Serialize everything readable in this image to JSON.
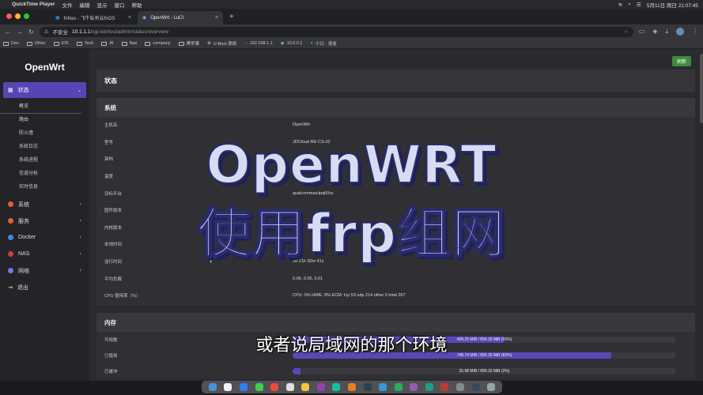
{
  "menubar": {
    "app_name": "QuickTime Player",
    "menus": [
      "文件",
      "编辑",
      "显示",
      "窗口",
      "帮助"
    ],
    "datetime": "5月11日 周日 21:07:45"
  },
  "tabs": [
    {
      "label": "fnNas - 飞牛私有云fnOS"
    },
    {
      "label": "OpenWrt - LuCI"
    }
  ],
  "address": {
    "security": "不安全",
    "host": "10.1.1.1",
    "path": "/cgi-bin/luci/admin/status/overview"
  },
  "bookmarks": [
    "Dev",
    "Other",
    "iOS",
    "Tech",
    "AI",
    "Nas",
    "company",
    "黑苹果",
    "U-Boot 更新",
    "192.168.1.1",
    "10.0.0.1",
    "小记 · 语雀"
  ],
  "sidebar": {
    "logo": "OpenWrt",
    "active_section": "状态",
    "subitems": [
      "概览",
      "路由",
      "防火墙",
      "系统日志",
      "系统进程",
      "信道分析",
      "实时信息"
    ],
    "items": [
      {
        "label": "系统",
        "color": "#e0603a"
      },
      {
        "label": "服务",
        "color": "#e0603a"
      },
      {
        "label": "Docker",
        "color": "#3b8de0"
      },
      {
        "label": "NAS",
        "color": "#d03c3c"
      },
      {
        "label": "网络",
        "color": "#6a7fe0"
      },
      {
        "label": "退出",
        "color": "#cccccc"
      }
    ]
  },
  "content": {
    "refresh": "刷新",
    "page_title": "状态",
    "system_title": "系统",
    "system_rows": [
      {
        "k": "主机名",
        "v": "OpenWrt"
      },
      {
        "k": "型号",
        "v": "JDCloud RE-CS-02"
      },
      {
        "k": "架构",
        "v": ""
      },
      {
        "k": "温度",
        "v": ""
      },
      {
        "k": "目标平台",
        "v": "qualcommax/ipq60xx"
      },
      {
        "k": "固件版本",
        "v": ""
      },
      {
        "k": "内核版本",
        "v": ""
      },
      {
        "k": "本地时间",
        "v": ""
      },
      {
        "k": "运行时间",
        "v": "2d 21h 30m 41s"
      },
      {
        "k": "平均负载",
        "v": "0.06, 0.05, 0.01"
      },
      {
        "k": "CPU 使用率（%）",
        "v": "CPU: 0% HWE: 9% ECM: tcp 53 udp 214 other 0 total 267"
      }
    ],
    "memory_title": "内存",
    "memory_rows": [
      {
        "k": "可用数",
        "text": "499.25 MiB / 899.32 MiB (55%)",
        "pct": 55
      },
      {
        "k": "已使用",
        "text": "748.74 MiB / 899.32 MiB (83%)",
        "pct": 83
      },
      {
        "k": "已缓冲",
        "text": "25.98 MiB / 899.32 MiB (2%)",
        "pct": 2
      }
    ]
  },
  "overlay": {
    "line1": "OpenWRT",
    "line2": "使用frp组网",
    "subtitle": "或者说局域网的那个环境"
  }
}
